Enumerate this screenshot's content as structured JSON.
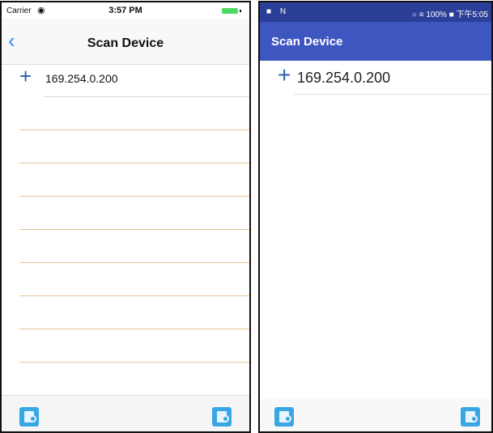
{
  "ios": {
    "status": {
      "carrier": "Carrier",
      "wifi": "◉",
      "time": "3:57 PM"
    },
    "nav": {
      "back": "‹",
      "title": "Scan Device"
    },
    "devices": [
      {
        "plus": "+",
        "ip": "169.254.0.200"
      }
    ],
    "toolbar": {
      "left_icon": "device-list-icon",
      "right_icon": "device-edit-icon"
    }
  },
  "android": {
    "status": {
      "left": "■ N",
      "right": "○ ≡ 100% ■ 下午5:05"
    },
    "appbar": {
      "title": "Scan Device"
    },
    "devices": [
      {
        "plus": "+",
        "ip": "169.254.0.200"
      }
    ],
    "toolbar": {
      "left_icon": "device-list-icon",
      "right_icon": "device-edit-icon"
    }
  },
  "colors": {
    "ios_accent": "#2a8bf2",
    "android_status": "#2c3f98",
    "android_appbar": "#3e56c0",
    "plus": "#2a5fa8",
    "tool_icon": "#3aa7e5"
  }
}
